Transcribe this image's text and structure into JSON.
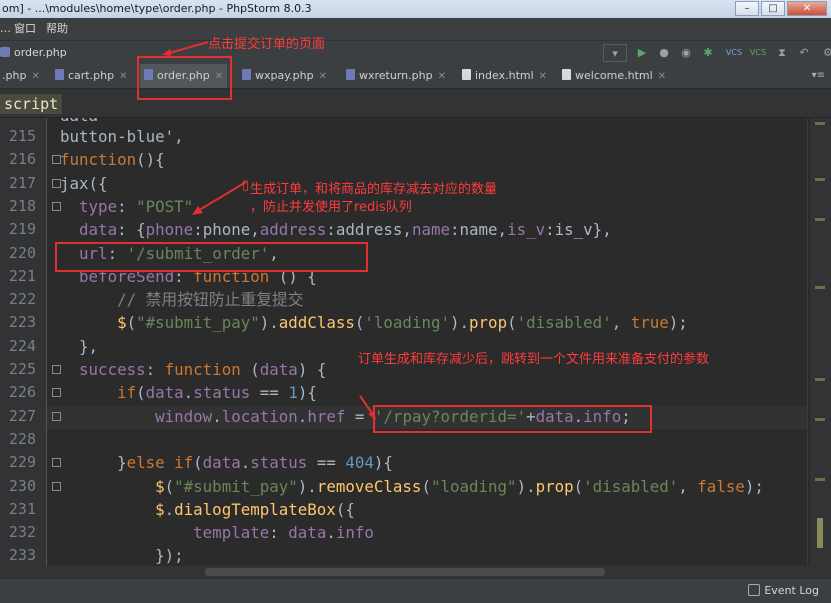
{
  "window": {
    "title": "om] - ...\\modules\\home\\type\\order.php - PhpStorm 8.0.3"
  },
  "menu": {
    "items": [
      "窗口",
      "帮助"
    ]
  },
  "nav": {
    "file": "order.php"
  },
  "tabs": [
    {
      "label": ".php"
    },
    {
      "label": "cart.php"
    },
    {
      "label": "order.php"
    },
    {
      "label": "wxpay.php"
    },
    {
      "label": "wxreturn.php"
    },
    {
      "label": "index.html"
    },
    {
      "label": "welcome.html"
    }
  ],
  "breadcrumb": {
    "tag": "script"
  },
  "lines": [
    {
      "num": "215",
      "html": "<span class=\"w\">button-blue',</span>"
    },
    {
      "num": "216",
      "html": "<span class=\"k\">function</span>(){"
    },
    {
      "num": "217",
      "html": "jax({"
    },
    {
      "num": "218",
      "html": "  <span class=\"p\">type</span>: <span class=\"s\">\"POST\"</span>,"
    },
    {
      "num": "219",
      "html": "  <span class=\"p\">data</span>: {<span class=\"p\">phone</span>:phone,<span class=\"p\">address</span>:address,<span class=\"p\">name</span>:name,<span class=\"p\">is_v</span>:is_v},"
    },
    {
      "num": "220",
      "html": "  <span class=\"p\">url</span>: <span class=\"s\">'/submit_order'</span>,"
    },
    {
      "num": "221",
      "html": "  <span class=\"p\">beforeSend</span>: <span class=\"k\">function</span> () {"
    },
    {
      "num": "222",
      "html": "      <span class=\"c\">// 禁用按钮防止重复提交</span>"
    },
    {
      "num": "223",
      "html": "      <span class=\"f\">$</span>(<span class=\"s\">\"#submit_pay\"</span>).<span class=\"f\">addClass</span>(<span class=\"s\">'loading'</span>).<span class=\"f\">prop</span>(<span class=\"s\">'disabled'</span>, <span class=\"k\">true</span>);"
    },
    {
      "num": "224",
      "html": "  },"
    },
    {
      "num": "225",
      "html": "  <span class=\"p\">success</span>: <span class=\"k\">function</span> (<span class=\"p\">data</span>) {"
    },
    {
      "num": "226",
      "html": "      <span class=\"k\">if</span>(<span class=\"p\">data</span>.<span class=\"p\">status</span> == <span class=\"n\">1</span>){"
    },
    {
      "num": "227",
      "html": "          <span class=\"p\">window</span>.<span class=\"p\">location</span>.<span class=\"p\">href</span> = <span class=\"s\">'/rpay?orderid='</span>+<span class=\"p\">data</span>.<span class=\"p\">info</span>;"
    },
    {
      "num": "228",
      "html": ""
    },
    {
      "num": "229",
      "html": "      }<span class=\"k\">else if</span>(<span class=\"p\">data</span>.<span class=\"p\">status</span> == <span class=\"n\">404</span>){"
    },
    {
      "num": "230",
      "html": "          <span class=\"f\">$</span>(<span class=\"s\">\"#submit_pay\"</span>).<span class=\"f\">removeClass</span>(<span class=\"s\">\"loading\"</span>).<span class=\"f\">prop</span>(<span class=\"s\">'disabled'</span>, <span class=\"k\">false</span>);"
    },
    {
      "num": "231",
      "html": "          <span class=\"f\">$</span>.<span class=\"f\">dialogTemplateBox</span>({"
    },
    {
      "num": "232",
      "html": "              <span class=\"p\">template</span>: <span class=\"p\">data</span>.<span class=\"p\">info</span>"
    },
    {
      "num": "233",
      "html": "          });"
    }
  ],
  "annotations": {
    "tab": "点击提交订单的页面",
    "order_line1": "生成订单，和将商品的库存减去对应的数量",
    "order_line2": "，防止并发使用了redis队列",
    "redirect": "订单生成和库存减少后，跳转到一个文件用来准备支付的参数"
  },
  "status": {
    "event_log": "Event Log"
  },
  "colors": {
    "annotation": "#e03030"
  }
}
